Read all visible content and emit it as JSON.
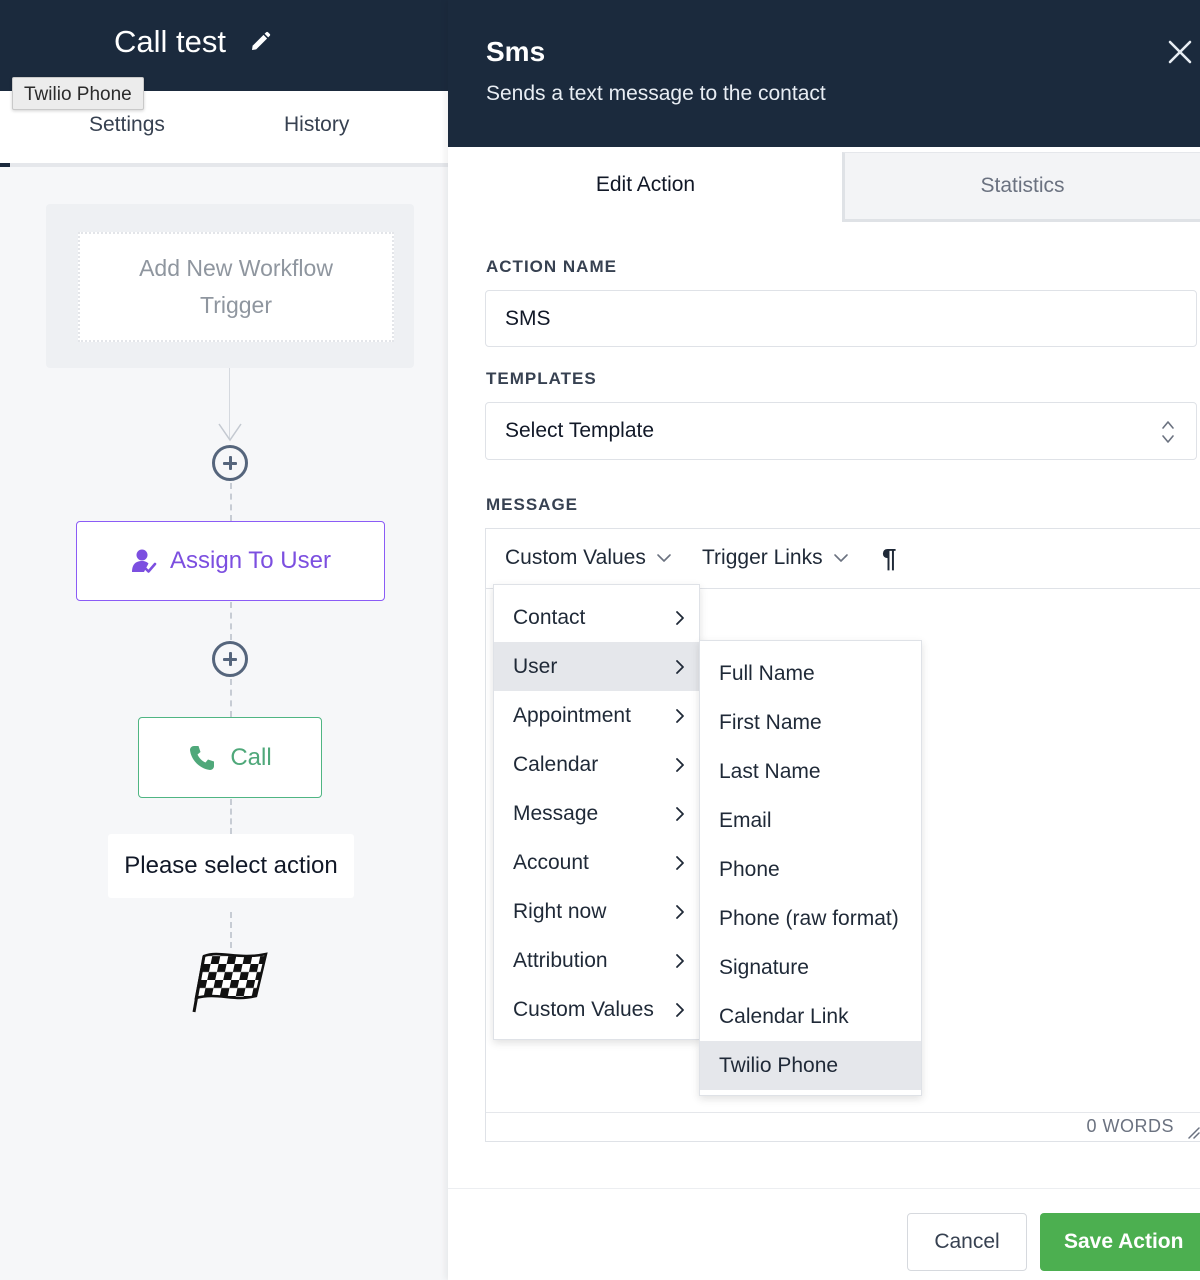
{
  "workflow": {
    "title": "Call test",
    "tooltip": "Twilio Phone",
    "tabs": [
      "Settings",
      "History"
    ],
    "trigger_placeholder": "Add New Workflow Trigger",
    "nodes": {
      "assign": "Assign To User",
      "call": "Call",
      "select": "Please select action"
    }
  },
  "drawer": {
    "title": "Sms",
    "subtitle": "Sends a text message to the contact",
    "tabs": [
      "Edit Action",
      "Statistics"
    ],
    "action_name_label": "ACTION NAME",
    "action_name_value": "SMS",
    "templates_label": "TEMPLATES",
    "template_selected": "Select Template",
    "message_label": "MESSAGE",
    "toolbar": {
      "custom_values": "Custom Values",
      "trigger_links": "Trigger Links",
      "paragraph": "¶"
    },
    "word_count": "0 WORDS",
    "cancel": "Cancel",
    "save": "Save Action"
  },
  "menu_level1": [
    "Contact",
    "User",
    "Appointment",
    "Calendar",
    "Message",
    "Account",
    "Right now",
    "Attribution",
    "Custom Values"
  ],
  "menu_level1_active": "User",
  "menu_level2": [
    "Full Name",
    "First Name",
    "Last Name",
    "Email",
    "Phone",
    "Phone (raw format)",
    "Signature",
    "Calendar Link",
    "Twilio Phone"
  ],
  "menu_level2_highlight": "Twilio Phone",
  "colors": {
    "header": "#1b2a3d",
    "assign_accent": "#7c4fe0",
    "call_accent": "#4fa87a",
    "save_green": "#4caf50"
  }
}
